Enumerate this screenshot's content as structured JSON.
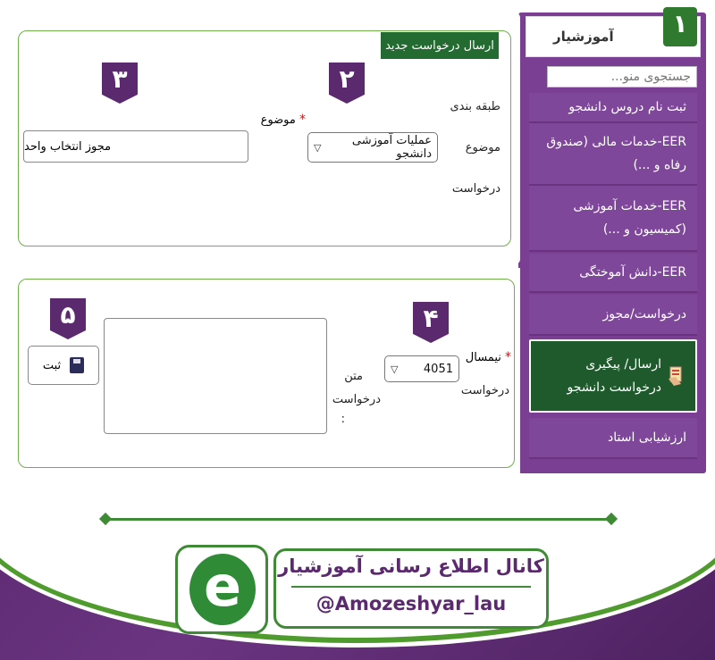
{
  "sidebar": {
    "title": "آموزشیار",
    "search_placeholder": "جستجوی منو...",
    "items": [
      {
        "label": "ثبت نام دروس دانشجو"
      },
      {
        "label": "EER-خدمات مالی (صندوق رفاه و ...)"
      },
      {
        "label": "EER-خدمات آموزشی (کمیسیون و ...)"
      },
      {
        "label": "EER-دانش آموختگی"
      },
      {
        "label": "درخواست/مجوز"
      },
      {
        "label": "ارسال/ پیگیری درخواست دانشجو"
      },
      {
        "label": "ارزشیابی استاد"
      }
    ]
  },
  "badges": {
    "one": "۱",
    "two": "۲",
    "three": "۳",
    "four": "۴",
    "five": "۵"
  },
  "panel1": {
    "title": "ارسال درخواست جدید",
    "category_label_1": "طبقه بندی",
    "category_label_2": "موضوع",
    "category_label_3": "درخواست",
    "category_value": "عملیات آموزشی دانشجو",
    "subject_required": "*",
    "subject_label": "موضوع",
    "subject_value": "مجوز انتخاب واحد"
  },
  "panel2": {
    "semester_required": "*",
    "semester_label_1": "نیمسال",
    "semester_label_2": "درخواست",
    "semester_value": "4051",
    "text_label_1": "متن",
    "text_label_2": "درخواست",
    "text_label_3": ":",
    "text_value": "",
    "save_label": "ثبت"
  },
  "footer": {
    "logo_letter": "e",
    "channel_title": "کانال اطلاع رسانی آموزشیار",
    "channel_handle": "@Amozeshyar_lau"
  },
  "colors": {
    "purple": "#5b2a6e",
    "green": "#2f7a2f",
    "menu": "#7f479a",
    "active": "#1f5a2c"
  }
}
